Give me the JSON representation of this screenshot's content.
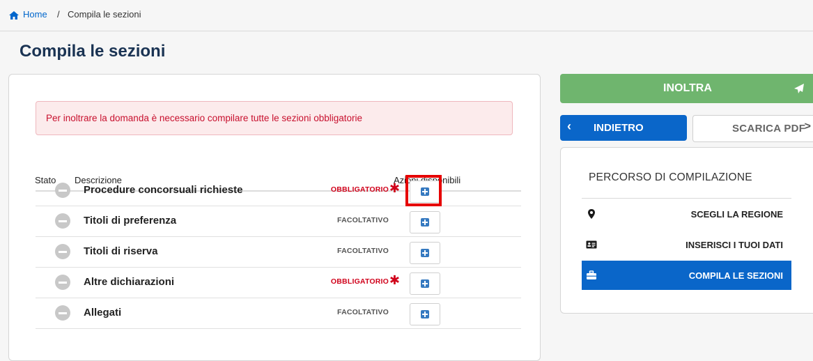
{
  "breadcrumb": {
    "home": "Home",
    "separator": "/",
    "current": "Compila le sezioni"
  },
  "page": {
    "title": "Compila le sezioni"
  },
  "alert": {
    "message": "Per inoltrare la domanda è necessario compilare tutte le sezioni obbligatorie"
  },
  "table": {
    "headers": {
      "status": "Stato",
      "description": "Descrizione",
      "actions": "Azioni disponibili"
    },
    "rows": [
      {
        "title": "Procedure concorsuali richieste",
        "requirement": "OBBLIGATORIO",
        "required": true
      },
      {
        "title": "Titoli di preferenza",
        "requirement": "FACOLTATIVO",
        "required": false
      },
      {
        "title": "Titoli di riserva",
        "requirement": "FACOLTATIVO",
        "required": false
      },
      {
        "title": "Altre dichiarazioni",
        "requirement": "OBBLIGATORIO",
        "required": true
      },
      {
        "title": "Allegati",
        "requirement": "FACOLTATIVO",
        "required": false
      }
    ],
    "required_marker": "✱"
  },
  "sidebar": {
    "submit_label": "INOLTRA",
    "back_label": "INDIETRO",
    "back_chevron": "‹",
    "pdf_label": "SCARICA PDF",
    "pdf_chevron": ">",
    "path_title": "PERCORSO DI COMPILAZIONE",
    "path_items": [
      {
        "label": "SCEGLI LA REGIONE",
        "icon": "map-marker-icon"
      },
      {
        "label": "INSERISCI I TUOI DATI",
        "icon": "id-card-icon"
      },
      {
        "label": "COMPILA LE SEZIONI",
        "icon": "briefcase-icon",
        "active": true
      }
    ]
  },
  "colors": {
    "primary": "#0a66c9",
    "submit": "#6fb56e",
    "required": "#d0021b",
    "alert_bg": "#fcebec",
    "highlight": "#e60000",
    "title": "#1a3353"
  }
}
